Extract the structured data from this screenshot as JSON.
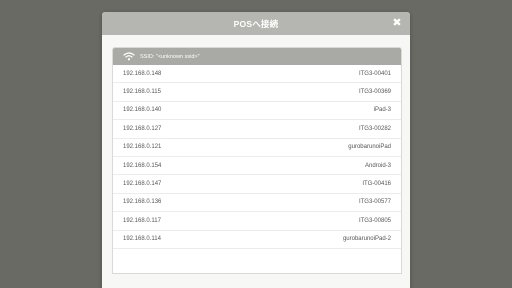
{
  "dialog": {
    "title": "POSへ接続",
    "close_label": "✖"
  },
  "ssid": {
    "text": "SSID: \"<unknown ssid>\""
  },
  "devices": [
    {
      "ip": "192.168.0.148",
      "name": "ITG3-00401"
    },
    {
      "ip": "192.168.0.115",
      "name": "ITG3-00369"
    },
    {
      "ip": "192.168.0.140",
      "name": "iPad-3"
    },
    {
      "ip": "192.168.0.127",
      "name": "ITG3-00282"
    },
    {
      "ip": "192.168.0.121",
      "name": "gurobarunoiPad"
    },
    {
      "ip": "192.168.0.154",
      "name": "Android-3"
    },
    {
      "ip": "192.168.0.147",
      "name": "ITG-00416"
    },
    {
      "ip": "192.168.0.136",
      "name": "ITG3-00577"
    },
    {
      "ip": "192.168.0.117",
      "name": "ITG3-00805"
    },
    {
      "ip": "192.168.0.114",
      "name": "gurobarunoiPad-2"
    }
  ]
}
